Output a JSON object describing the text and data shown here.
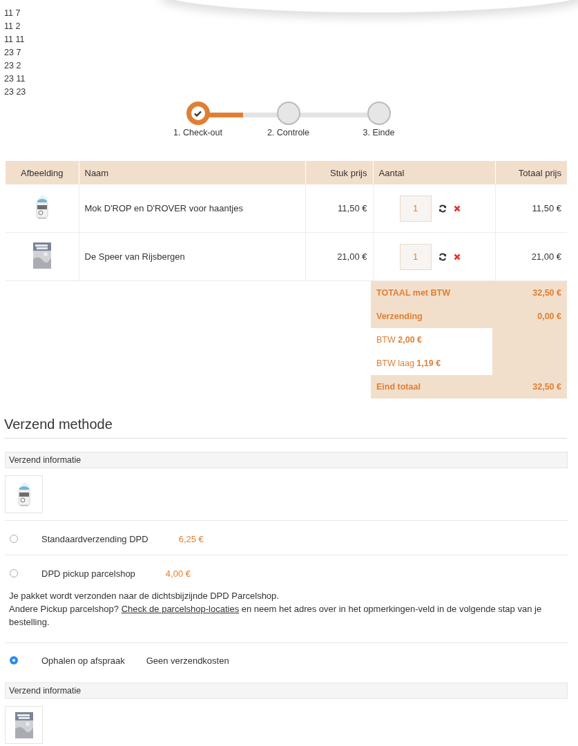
{
  "debug_lines": [
    "11 7",
    "11 2",
    "11 11",
    "23 7",
    "23 2",
    "23 11",
    "23 23"
  ],
  "steps": [
    {
      "label": "1. Check-out",
      "completed": true
    },
    {
      "label": "2. Controle",
      "completed": false
    },
    {
      "label": "3. Einde",
      "completed": false
    }
  ],
  "cart": {
    "columns": [
      "Afbeelding",
      "Naam",
      "Stuk prijs",
      "Aantal",
      "Totaal prijs"
    ],
    "rows": [
      {
        "kind": "mug",
        "name": "Mok D'ROP en D'ROVER voor haantjes",
        "unit_price": "11,50 €",
        "quantity": "1",
        "total": "11,50 €"
      },
      {
        "kind": "book",
        "name": "De Speer van Rijsbergen",
        "unit_price": "21,00 €",
        "quantity": "1",
        "total": "21,00 €"
      }
    ]
  },
  "totals": [
    {
      "kind": "sum",
      "label": "TOTAAL met BTW",
      "value": "32,50 €"
    },
    {
      "kind": "sum",
      "label": "Verzending",
      "value": "0,00 €"
    },
    {
      "kind": "tax",
      "label": "BTW **2,00 €**"
    },
    {
      "kind": "tax",
      "label": "BTW laag **1,19 €**"
    },
    {
      "kind": "sum",
      "label": "Eind totaal",
      "value": "32,50 €"
    }
  ],
  "shipping": {
    "title": "Verzend methode",
    "blocks": [
      {
        "kind": "info",
        "header": "Verzend informatie",
        "thumbnail": {
          "kind": "mug"
        }
      },
      {
        "kind": "option",
        "label": "Standaardverzending DPD",
        "price": "6,25 €",
        "selected": false
      },
      {
        "kind": "option",
        "label": "DPD pickup parcelshop",
        "price": "4,00 €",
        "selected": false,
        "note": {
          "line1": "Je pakket wordt verzonden naar de dichtsbijzijnde DPD Parcelshop.",
          "before_link": "Andere Pickup parcelshop?",
          "link": "Check de parcelshop-locaties",
          "after_link": "en neem het adres over in het opmerkingen-veld in de volgende stap van je bestelling."
        }
      },
      {
        "kind": "free_option",
        "label": "Ophalen op afspraak",
        "price": "Geen verzendkosten",
        "selected": true
      },
      {
        "kind": "info",
        "header": "Verzend informatie",
        "thumbnail": {
          "kind": "book"
        }
      }
    ]
  }
}
